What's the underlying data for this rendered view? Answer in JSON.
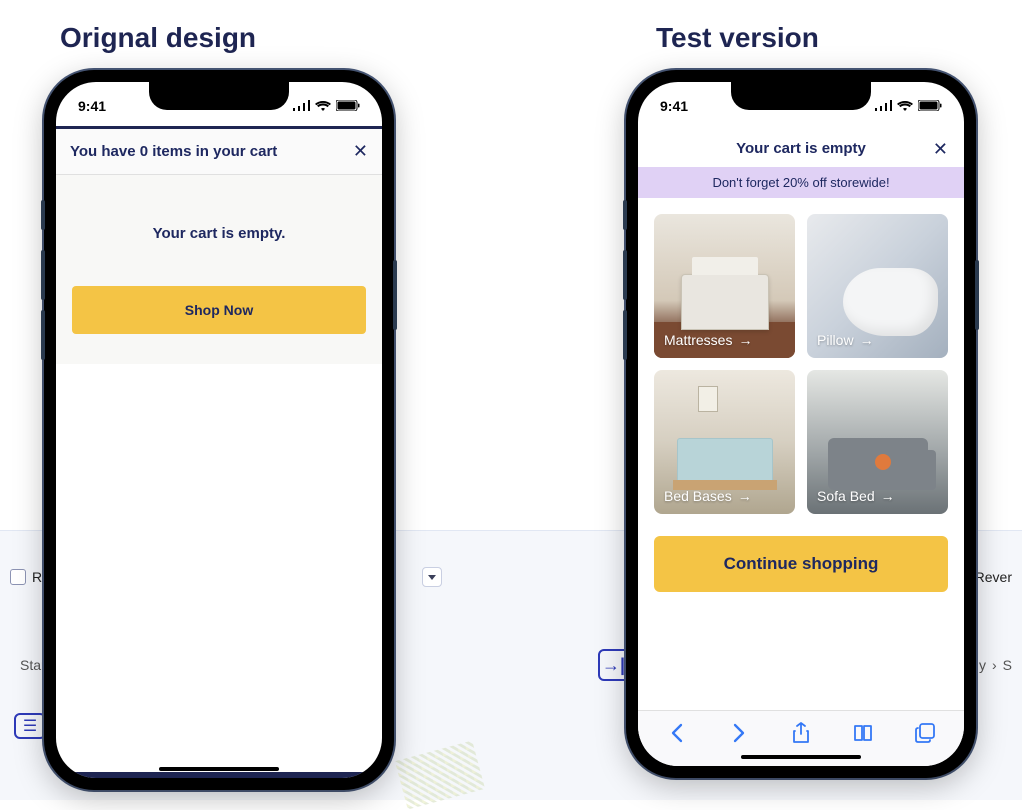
{
  "headings": {
    "original": "Orignal design",
    "test": "Test version"
  },
  "status_bar": {
    "time": "9:41"
  },
  "original": {
    "header_title": "You have 0 items in your cart",
    "empty_message": "Your cart is empty.",
    "cta_label": "Shop Now"
  },
  "test": {
    "header_title": "Your cart is empty",
    "promo_banner": "Don't forget 20% off storewide!",
    "categories": [
      {
        "label": "Mattresses"
      },
      {
        "label": "Pillow"
      },
      {
        "label": "Bed Bases"
      },
      {
        "label": "Sofa Bed"
      }
    ],
    "cta_label": "Continue shopping"
  },
  "background": {
    "checkbox_r": "R",
    "revenue": "Rever",
    "start": "Start",
    "breadcrumb_y": "y",
    "breadcrumb_sep": "›",
    "breadcrumb_s": "S"
  }
}
